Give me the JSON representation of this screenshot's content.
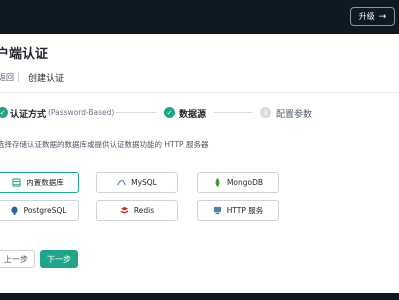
{
  "header": {
    "upgrade_label": "升级",
    "upgrade_icon": "arrow-right-icon"
  },
  "page": {
    "title": "户端认证"
  },
  "breadcrumb": {
    "back_label": "返回",
    "current_label": "创建认证"
  },
  "steps": [
    {
      "label": "认证方式",
      "sublabel": "(Password-Based)",
      "status": "done"
    },
    {
      "label": "数据源",
      "status": "done"
    },
    {
      "number": "3",
      "label": "配置参数",
      "status": "pending"
    }
  ],
  "datasource": {
    "description": "选择存储认证数据的数据库或提供认证数据功能的 HTTP 服务器",
    "options": [
      {
        "label": "内置数据库",
        "icon": "built-in-database-icon",
        "selected": true
      },
      {
        "label": "MySQL",
        "icon": "mysql-icon",
        "selected": false
      },
      {
        "label": "MongoDB",
        "icon": "mongodb-icon",
        "selected": false
      },
      {
        "label": "PostgreSQL",
        "icon": "postgresql-icon",
        "selected": false
      },
      {
        "label": "Redis",
        "icon": "redis-icon",
        "selected": false
      },
      {
        "label": "HTTP 服务",
        "icon": "http-server-icon",
        "selected": false
      }
    ]
  },
  "actions": {
    "prev_label": "上一步",
    "next_label": "下一步"
  },
  "colors": {
    "accent": "#20a58a",
    "topbar": "#0f1923",
    "pending": "#d9dbdf"
  }
}
